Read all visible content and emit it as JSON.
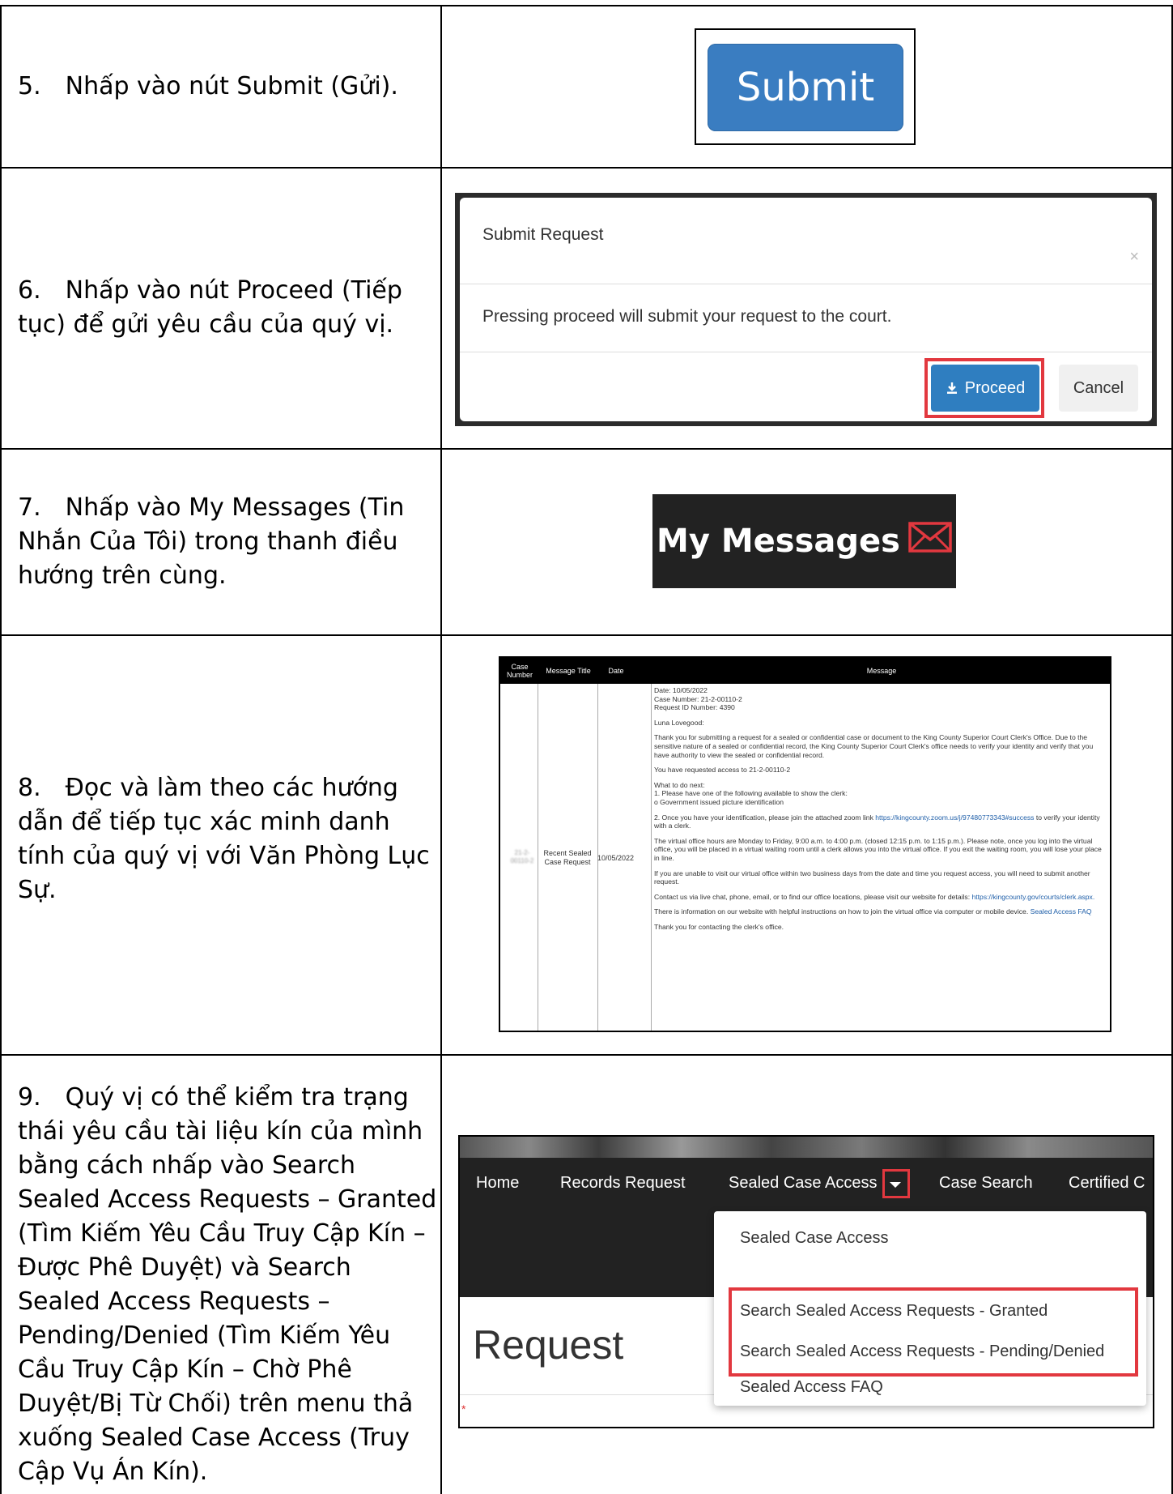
{
  "steps": [
    {
      "num": "5.",
      "text": "Nhấp vào nút Submit (Gửi)."
    },
    {
      "num": "6.",
      "text": "Nhấp vào nút Proceed (Tiếp tục) để gửi yêu cầu của quý vị."
    },
    {
      "num": "7.",
      "text": "Nhấp vào My Messages (Tin Nhắn Của Tôi) trong thanh điều hướng trên cùng."
    },
    {
      "num": "8.",
      "text": "Đọc và làm theo các hướng dẫn để tiếp tục xác minh danh tính của quý vị với Văn Phòng Lục Sự."
    },
    {
      "num": "9.",
      "text": "Quý vị có thể kiểm tra trạng thái yêu cầu tài liệu kín của mình bằng cách nhấp vào Search Sealed Access Requests – Granted (Tìm Kiếm Yêu Cầu Truy Cập Kín – Được Phê Duyệt) và Search Sealed Access Requests – Pending/Denied (Tìm Kiếm Yêu Cầu Truy Cập Kín – Chờ Phê Duyệt/Bị Từ Chối) trên menu thả xuống Sealed Case Access (Truy Cập Vụ Án Kín)."
    }
  ],
  "submit_shot": {
    "label": "Submit",
    "color": "#3a7dc1"
  },
  "modal_shot": {
    "title": "Submit Request",
    "close": "×",
    "body": "Pressing proceed will submit your request to the court.",
    "proceed": "Proceed",
    "cancel": "Cancel",
    "highlight_color": "#e2383f"
  },
  "messages_shot": {
    "label": "My Messages",
    "icon": "envelope-icon",
    "icon_color": "#e2383f"
  },
  "message_table": {
    "headers": {
      "case": "Case Number",
      "title": "Message Title",
      "date": "Date",
      "message": "Message"
    },
    "row": {
      "case": "21-2-00110-2",
      "title": "Recent Sealed Case Request",
      "date": "10/05/2022",
      "lines": {
        "l1": "Date: 10/05/2022",
        "l2": "Case Number: 21-2-00110-2",
        "l3": "Request ID Number: 4390",
        "l4": "Luna Lovegood:",
        "l5": "Thank you for submitting a request for a sealed or confidential case or document to the King County Superior Court Clerk's Office. Due to the sensitive nature of a sealed or confidential record, the King County Superior Court Clerk's office needs to verify your identity and verify that you have authority to view the sealed or confidential record.",
        "l6": "You have requested access to 21-2-00110-2",
        "l7": "What to do next:",
        "l8": "1. Please have one of the following available to show the clerk:",
        "l9": "o Government issued picture identification",
        "l10a": "2. Once you have your identification, please join the attached zoom link ",
        "l10link": "https://kingcounty.zoom.us/j/97480773343#success",
        "l10b": " to verify your identity with a clerk.",
        "l11": "The virtual office hours are Monday to Friday, 9:00 a.m. to 4:00 p.m. (closed 12:15 p.m. to 1:15 p.m.). Please note, once you log into the virtual office, you will be placed in a virtual waiting room until a clerk allows you into the virtual office. If you exit the waiting room, you will lose your place in line.",
        "l12": "If you are unable to visit our virtual office within two business days from the date and time you request access, you will need to submit another request.",
        "l13a": "Contact us via live chat, phone, email, or to find our office locations, please visit our website for details: ",
        "l13link": "https://kingcounty.gov/courts/clerk.aspx.",
        "l14a": "There is information on our website with helpful instructions on how to join the virtual office via computer or mobile device. ",
        "l14link": "Sealed Access FAQ",
        "l15": "Thank you for contacting the clerk's office."
      }
    }
  },
  "nav_shot": {
    "nav": {
      "home": "Home",
      "records": "Records Request",
      "sealed": "Sealed Case Access",
      "case_search": "Case Search",
      "certified": "Certified C"
    },
    "dropdown": {
      "i1": "Sealed Case Access",
      "i2": "Search Sealed Access Requests - Granted",
      "i3": "Search Sealed Access Requests - Pending/Denied",
      "i4": "Sealed Access FAQ"
    },
    "heading": "Request",
    "required_mark": "*"
  }
}
